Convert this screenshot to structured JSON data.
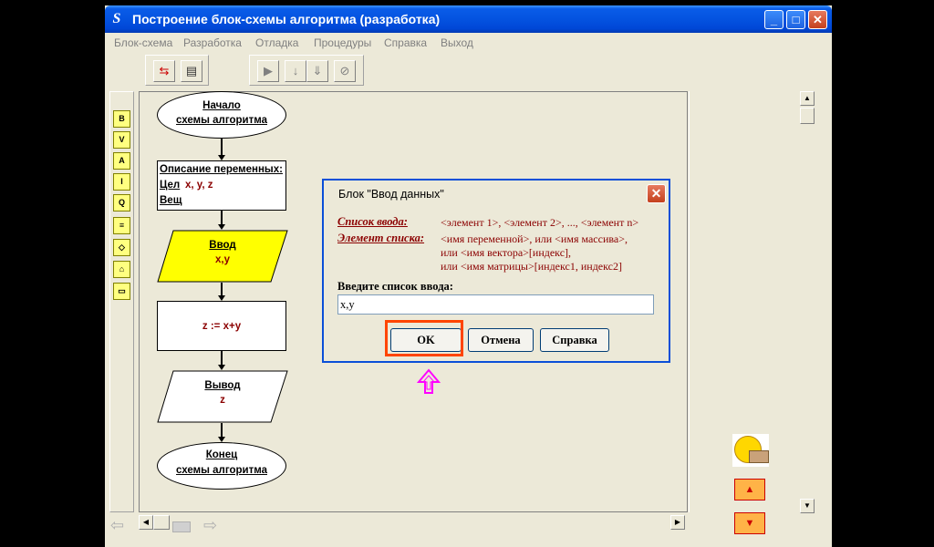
{
  "window": {
    "title": "Построение блок-схемы алгоритма (разработка)",
    "icon_letter": "S"
  },
  "title_buttons": {
    "minimize": "_",
    "maximize": "□",
    "close": "✕"
  },
  "menu": [
    "Блок-схема",
    "Разработка",
    "Отладка",
    "Процедуры",
    "Справка",
    "Выход"
  ],
  "palette": [
    "B",
    "V",
    "A",
    "I",
    "Q",
    "≡",
    "◇",
    "⌂",
    "▭"
  ],
  "flowchart": {
    "start": {
      "line1": "Начало",
      "line2": "схемы алгоритма"
    },
    "declare": {
      "title": "Описание переменных:",
      "type1": "Цел",
      "vars1": "x, y, z",
      "type2": "Вещ"
    },
    "input": {
      "title": "Ввод",
      "vars": "x,y"
    },
    "process": {
      "expr": "z := x+y"
    },
    "output": {
      "title": "Вывод",
      "vars": "z"
    },
    "end": {
      "line1": "Конец",
      "line2": "схемы алгоритма"
    }
  },
  "dialog": {
    "title": "Блок \"Ввод данных\"",
    "list_key": "Список ввода:",
    "list_text": "<элемент 1>, <элемент 2>, ..., <элемент n>",
    "elem_key": "Элемент списка:",
    "elem_line1": "<имя переменной>,  или  <имя массива>,",
    "elem_line2": "или   <имя вектора>[индекс],",
    "elem_line3": "или   <имя матрицы>[индекс1, индекс2]",
    "prompt": "Введите список ввода:",
    "input_value": "x,y",
    "ok": "OK",
    "cancel": "Отмена",
    "help": "Справка"
  },
  "colors": {
    "accent": "#0453e0",
    "input_block": "#ffff00",
    "highlight": "#ff4500",
    "hint_text": "#8b0000",
    "cursor": "#ff00ff"
  }
}
